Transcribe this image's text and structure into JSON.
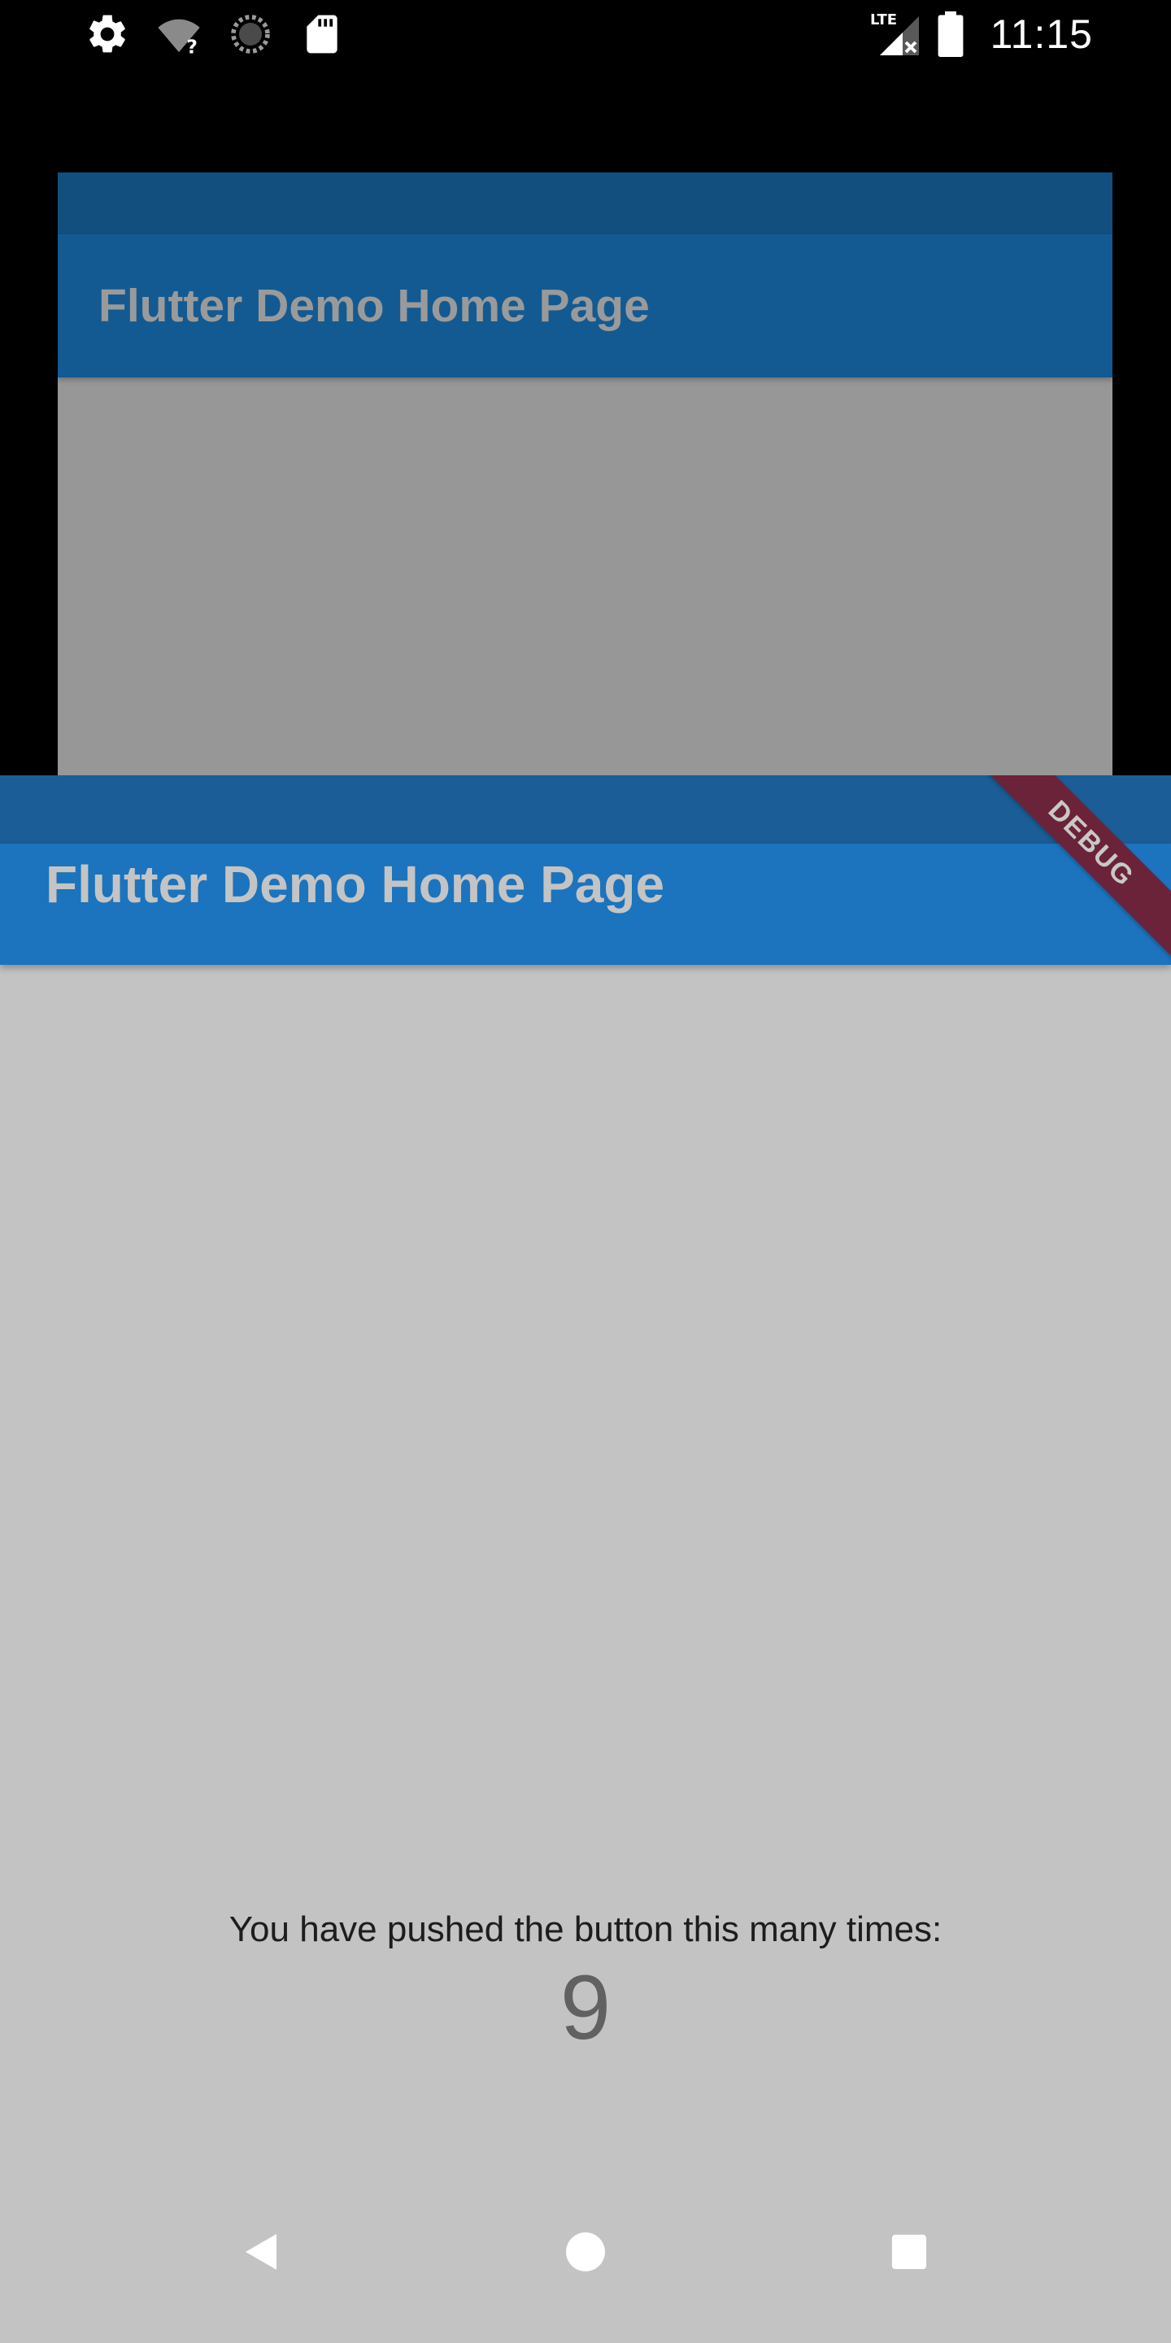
{
  "status_bar": {
    "time": "11:15",
    "network_label": "LTE",
    "icons": [
      "gear-icon",
      "wifi-question-icon",
      "sync-progress-icon",
      "sd-card-icon",
      "lte-icon",
      "signal-off-icon",
      "battery-icon"
    ]
  },
  "background_card": {
    "title": "Flutter Demo Home Page"
  },
  "app": {
    "title": "Flutter Demo Home Page",
    "debug_banner": "DEBUG",
    "counter_label": "You have pushed the button this many times:",
    "counter_value": "9"
  },
  "nav_bar": {
    "buttons": [
      "back-icon",
      "home-icon",
      "recents-icon"
    ]
  },
  "colors": {
    "app_bar": "#1b74bd",
    "status_bar_tint": "#1b5d96",
    "body_background": "#c3c3c3",
    "debug_banner": "#6b2339"
  }
}
